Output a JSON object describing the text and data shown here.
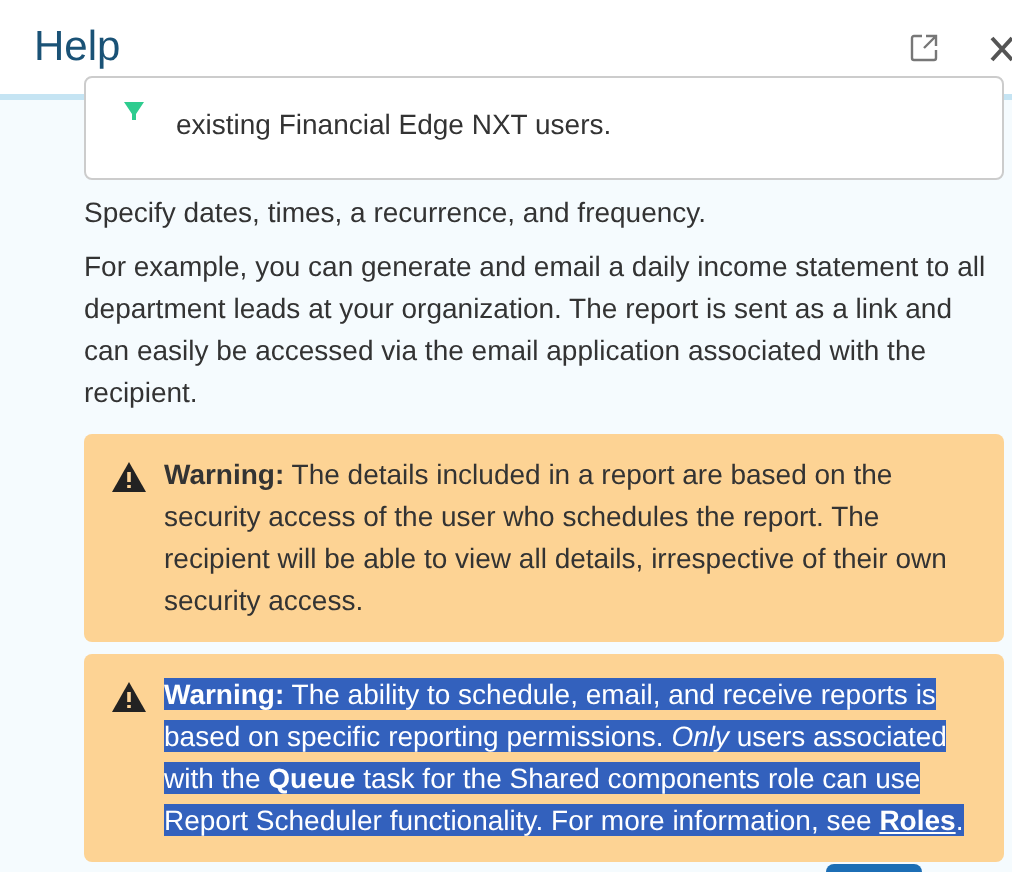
{
  "panel": {
    "title": "Help"
  },
  "note": {
    "text": "existing Financial Edge NXT users."
  },
  "paragraphs": [
    "Specify dates, times, a recurrence, and frequency.",
    "For example, you can generate and email a daily income statement to all department leads at your organization. The report is sent as a link and can easily be accessed via the email application associated with the recipient."
  ],
  "warnings": [
    {
      "text": "**Warning:** The details included in a report are based on the security access of the user who schedules the report. The recipient will be able to view all details, irrespective of their own security access.",
      "selected": false
    },
    {
      "text": "**Warning:** The ability to schedule, email, and receive reports is based on specific reporting permissions. *Only* users associated with the **Queue** task for the Shared components role can use Report Scheduler functionality. For more information, see ",
      "link": "Roles",
      "after": ".",
      "selected": true
    }
  ]
}
